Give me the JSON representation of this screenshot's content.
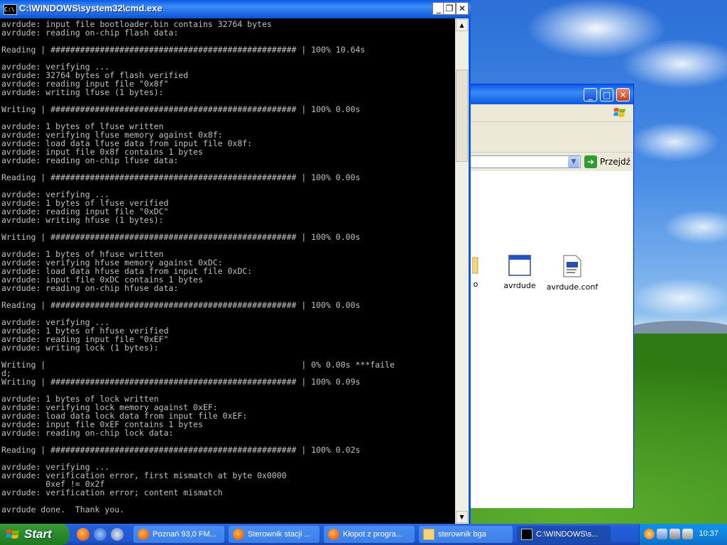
{
  "cmd": {
    "title": "C:\\WINDOWS\\system32\\cmd.exe",
    "icon_text": "C:\\",
    "minimize": "_",
    "maximize": "❐",
    "close": "✕",
    "output": [
      "avrdude: input file bootloader.bin contains 32764 bytes",
      "avrdude: reading on-chip flash data:",
      "",
      "Reading | ################################################## | 100% 10.64s",
      "",
      "avrdude: verifying ...",
      "avrdude: 32764 bytes of flash verified",
      "avrdude: reading input file \"0x8f\"",
      "avrdude: writing lfuse (1 bytes):",
      "",
      "Writing | ################################################## | 100% 0.00s",
      "",
      "avrdude: 1 bytes of lfuse written",
      "avrdude: verifying lfuse memory against 0x8f:",
      "avrdude: load data lfuse data from input file 0x8f:",
      "avrdude: input file 0x8f contains 1 bytes",
      "avrdude: reading on-chip lfuse data:",
      "",
      "Reading | ################################################## | 100% 0.00s",
      "",
      "avrdude: verifying ...",
      "avrdude: 1 bytes of lfuse verified",
      "avrdude: reading input file \"0xDC\"",
      "avrdude: writing hfuse (1 bytes):",
      "",
      "Writing | ################################################## | 100% 0.00s",
      "",
      "avrdude: 1 bytes of hfuse written",
      "avrdude: verifying hfuse memory against 0xDC:",
      "avrdude: load data hfuse data from input file 0xDC:",
      "avrdude: input file 0xDC contains 1 bytes",
      "avrdude: reading on-chip hfuse data:",
      "",
      "Reading | ################################################## | 100% 0.00s",
      "",
      "avrdude: verifying ...",
      "avrdude: 1 bytes of hfuse verified",
      "avrdude: reading input file \"0xEF\"",
      "avrdude: writing lock (1 bytes):",
      "",
      "Writing |                                                    | 0% 0.00s ***faile",
      "d;",
      "Writing | ################################################## | 100% 0.09s",
      "",
      "avrdude: 1 bytes of lock written",
      "avrdude: verifying lock memory against 0xEF:",
      "avrdude: load data lock data from input file 0xEF:",
      "avrdude: input file 0xEF contains 1 bytes",
      "avrdude: reading on-chip lock data:",
      "",
      "Reading | ################################################## | 100% 0.02s",
      "",
      "avrdude: verifying ...",
      "avrdude: verification error, first mismatch at byte 0x0000",
      "         0xef != 0x2f",
      "avrdude: verification error; content mismatch",
      "",
      "avrdude done.  Thank you."
    ]
  },
  "explorer": {
    "go_label": "Przejdź",
    "files": [
      {
        "label": "o",
        "icon": "folder-icon"
      },
      {
        "label": "avrdude",
        "icon": "exe-window-icon"
      },
      {
        "label": "avrdude.conf",
        "icon": "config-file-icon"
      }
    ]
  },
  "taskbar": {
    "start_label": "Start",
    "tasks": [
      {
        "label": "Poznań 93,0 FM...",
        "icon": "firefox-icon"
      },
      {
        "label": "Sterownik stacji ...",
        "icon": "firefox-icon"
      },
      {
        "label": "Kłopot z progra...",
        "icon": "firefox-icon"
      },
      {
        "label": "sterownik bga",
        "icon": "folder-icon"
      },
      {
        "label": "C:\\WINDOWS\\s...",
        "icon": "cmd-icon"
      }
    ],
    "clock": "10:37"
  },
  "colors": {
    "console_bg": "#000000",
    "console_fg": "#c0c0c0",
    "titlebar_blue": "#0a58e8",
    "taskbar_blue": "#245edb",
    "start_green": "#2e8b2e"
  }
}
